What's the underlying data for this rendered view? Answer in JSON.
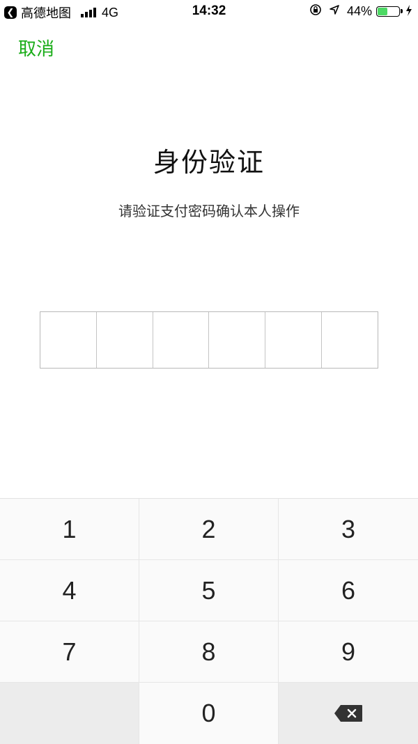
{
  "status_bar": {
    "back_app": "高德地图",
    "network": "4G",
    "time": "14:32",
    "battery_percent": "44%",
    "battery_level": 0.44,
    "battery_color": "#4cd964",
    "icons": [
      "back-arrow-icon",
      "signal-icon",
      "orientation-lock-icon",
      "location-icon",
      "battery-icon",
      "charging-icon"
    ]
  },
  "header": {
    "cancel_label": "取消",
    "accent_color": "#1aad19"
  },
  "main": {
    "title": "身份验证",
    "subtitle": "请验证支付密码确认本人操作",
    "pin_length": 6
  },
  "keypad": {
    "keys": [
      "1",
      "2",
      "3",
      "4",
      "5",
      "6",
      "7",
      "8",
      "9",
      "",
      "0",
      "delete"
    ]
  }
}
